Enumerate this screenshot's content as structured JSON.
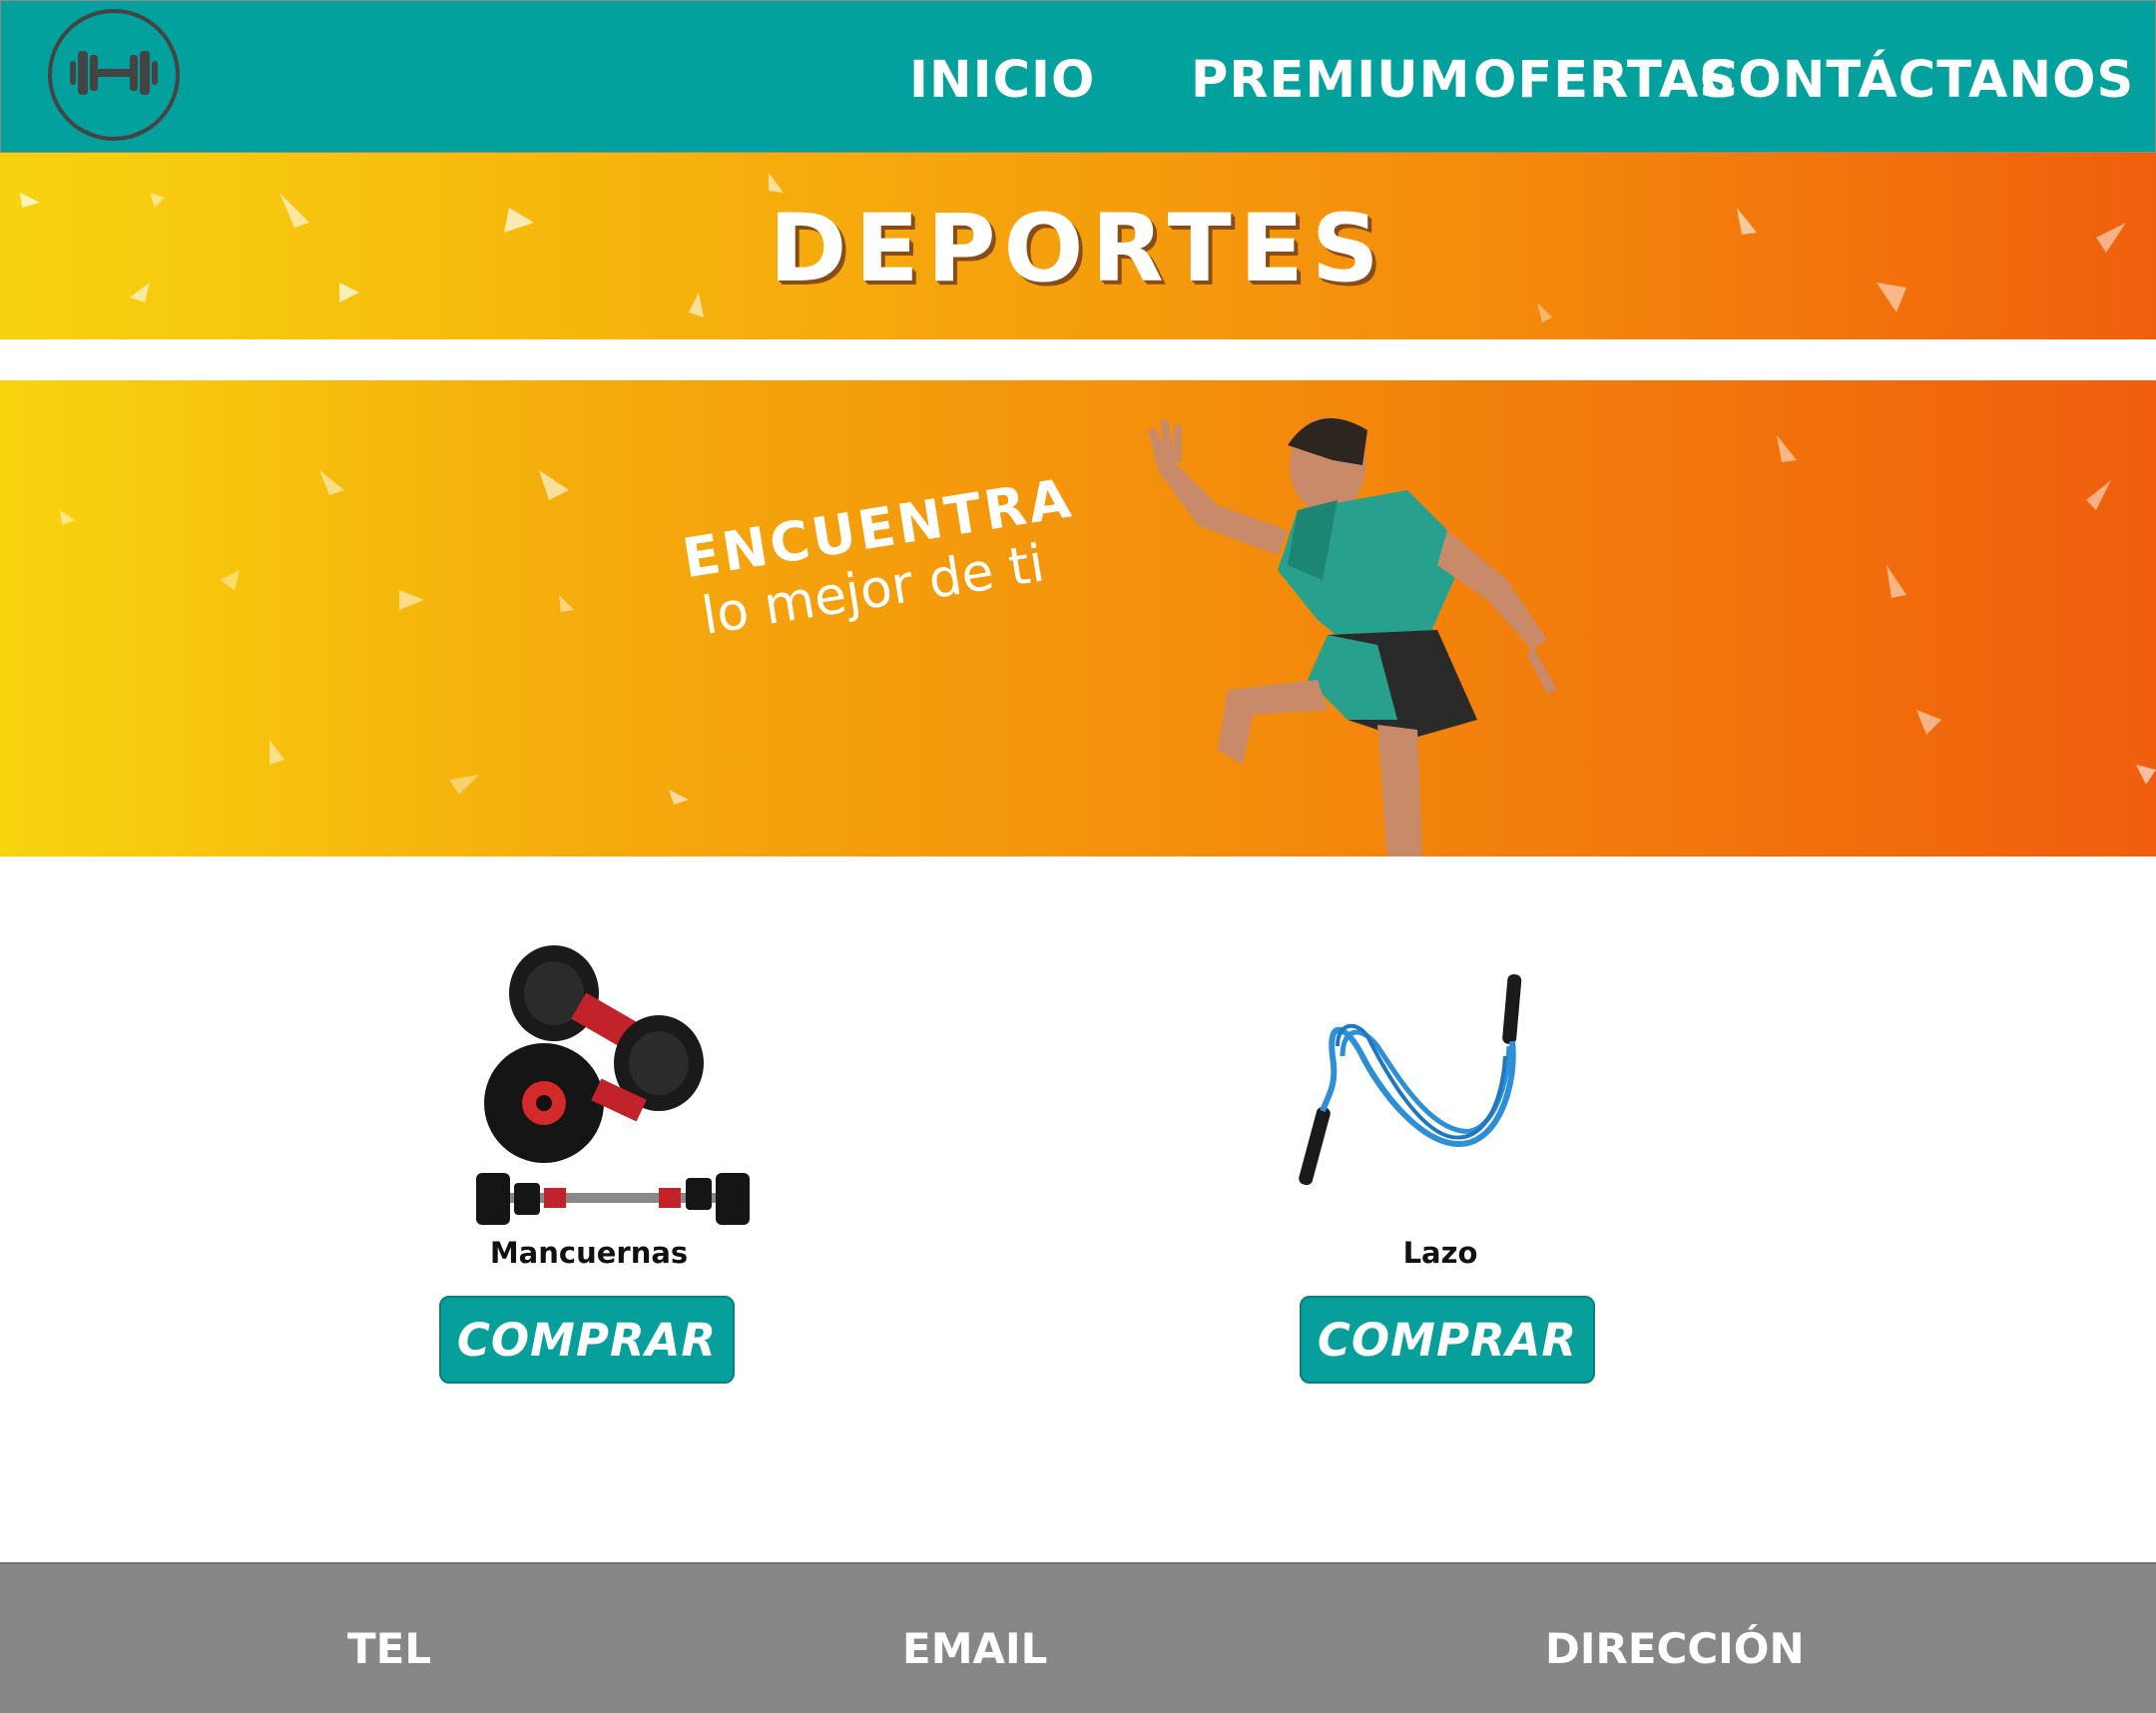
{
  "nav": {
    "logo_icon": "dumbbell-icon",
    "links": [
      "INICIO",
      "PREMIUM",
      "OFERTAS",
      "CONTÁCTANOS"
    ]
  },
  "banner": {
    "title": "DEPORTES"
  },
  "hero": {
    "headline": "ENCUENTRA",
    "subline": "lo mejor de ti"
  },
  "products": [
    {
      "name": "Mancuernas",
      "button": "COMPRAR"
    },
    {
      "name": "Lazo",
      "button": "COMPRAR"
    }
  ],
  "footer": {
    "tel": "TEL",
    "email": "EMAIL",
    "address": "DIRECCIÓN"
  },
  "colors": {
    "nav": "#02a19e",
    "button": "#079f9b",
    "footer": "#878787",
    "banner_start": "#f7d30f",
    "banner_end": "#f05f0d"
  }
}
